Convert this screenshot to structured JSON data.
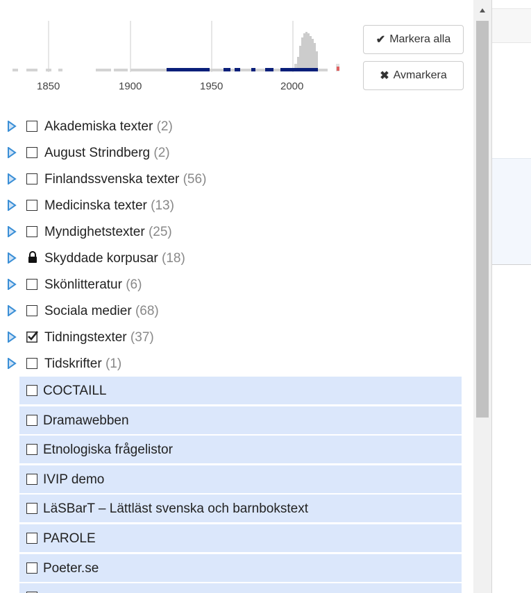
{
  "timeline": {
    "tick_labels": [
      "1850",
      "1900",
      "1950",
      "2000"
    ]
  },
  "buttons": {
    "select_all": "Markera alla",
    "deselect": "Avmarkera"
  },
  "folders": [
    {
      "label": "Akademiska texter",
      "count": "(2)",
      "state": "unchecked"
    },
    {
      "label": "August Strindberg",
      "count": "(2)",
      "state": "unchecked"
    },
    {
      "label": "Finlandssvenska texter",
      "count": "(56)",
      "state": "unchecked"
    },
    {
      "label": "Medicinska texter",
      "count": "(13)",
      "state": "unchecked"
    },
    {
      "label": "Myndighetstexter",
      "count": "(25)",
      "state": "unchecked"
    },
    {
      "label": "Skyddade korpusar",
      "count": "(18)",
      "state": "locked"
    },
    {
      "label": "Skönlitteratur",
      "count": "(6)",
      "state": "unchecked"
    },
    {
      "label": "Sociala medier",
      "count": "(68)",
      "state": "unchecked"
    },
    {
      "label": "Tidningstexter",
      "count": "(37)",
      "state": "checked"
    },
    {
      "label": "Tidskrifter",
      "count": "(1)",
      "state": "unchecked"
    }
  ],
  "corpora": [
    {
      "label": "COCTAILL"
    },
    {
      "label": "Dramawebben"
    },
    {
      "label": "Etnologiska frågelistor"
    },
    {
      "label": "IVIP demo"
    },
    {
      "label": "LäSBarT – Lättläst svenska och barnbokstext"
    },
    {
      "label": "PAROLE"
    },
    {
      "label": "Poeter.se"
    }
  ],
  "colors": {
    "accent_arrow": "#3b8fd6",
    "leaf_bg": "#dbe7fb",
    "timeline_selected": "#0a1f7a",
    "timeline_bar": "#cccccc"
  }
}
